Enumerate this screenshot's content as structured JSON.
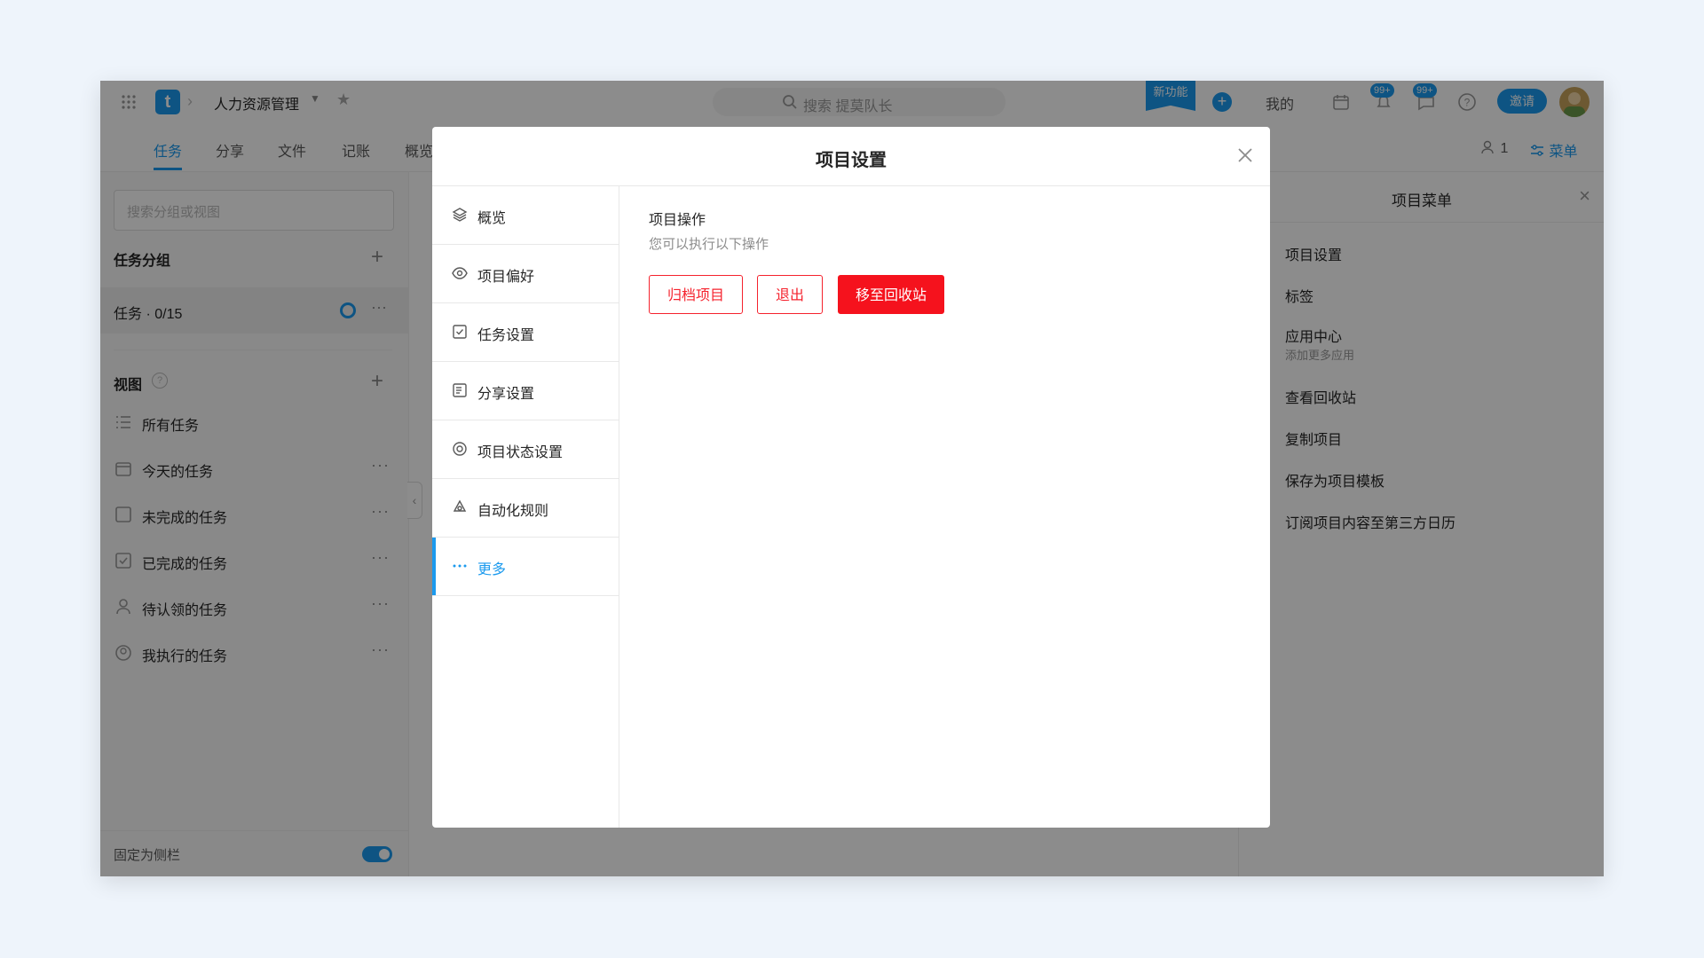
{
  "header": {
    "logo_letter": "t",
    "project_name": "人力资源管理",
    "search_placeholder": "搜索 提莫队长",
    "new_feature_label": "新功能",
    "plus_label": "+",
    "mine_label": "我的",
    "notification_badge": "99+",
    "message_badge": "99+",
    "invite_label": "邀请"
  },
  "tabs": [
    {
      "label": "任务",
      "active": true
    },
    {
      "label": "分享"
    },
    {
      "label": "文件"
    },
    {
      "label": "记账"
    },
    {
      "label": "概览"
    }
  ],
  "toolbar_right": {
    "members_count": "1",
    "menu_label": "菜单"
  },
  "sidebar": {
    "search_placeholder": "搜索分组或视图",
    "groups_heading": "任务分组",
    "group": {
      "label": "任务 · 0/15"
    },
    "views_heading": "视图",
    "views": [
      {
        "label": "所有任务",
        "icon": "list-icon"
      },
      {
        "label": "今天的任务",
        "icon": "calendar-icon"
      },
      {
        "label": "未完成的任务",
        "icon": "checkbox-empty-icon"
      },
      {
        "label": "已完成的任务",
        "icon": "checkbox-checked-icon"
      },
      {
        "label": "待认领的任务",
        "icon": "user-icon"
      },
      {
        "label": "我执行的任务",
        "icon": "user-circle-icon"
      }
    ],
    "footer_label": "固定为侧栏",
    "pinned": true
  },
  "right_panel": {
    "title": "项目菜单",
    "items": [
      {
        "label": "项目设置"
      },
      {
        "label": "标签"
      },
      {
        "label": "应用中心",
        "sub": "添加更多应用"
      },
      {
        "label": "查看回收站"
      },
      {
        "label": "复制项目"
      },
      {
        "label": "保存为项目模板"
      },
      {
        "label": "订阅项目内容至第三方日历"
      }
    ]
  },
  "modal": {
    "title": "项目设置",
    "nav": [
      {
        "label": "概览",
        "icon": "layers-icon"
      },
      {
        "label": "项目偏好",
        "icon": "eye-icon"
      },
      {
        "label": "任务设置",
        "icon": "task-check-icon"
      },
      {
        "label": "分享设置",
        "icon": "share-doc-icon"
      },
      {
        "label": "项目状态设置",
        "icon": "status-icon"
      },
      {
        "label": "自动化规则",
        "icon": "automation-icon"
      },
      {
        "label": "更多",
        "icon": "more-icon",
        "active": true
      }
    ],
    "section_title": "项目操作",
    "section_desc": "您可以执行以下操作",
    "buttons": {
      "archive": "归档项目",
      "quit": "退出",
      "trash": "移至回收站"
    }
  },
  "colors": {
    "accent": "#1b9aee",
    "danger": "#f5121d",
    "page_bg": "#eef4fb"
  }
}
